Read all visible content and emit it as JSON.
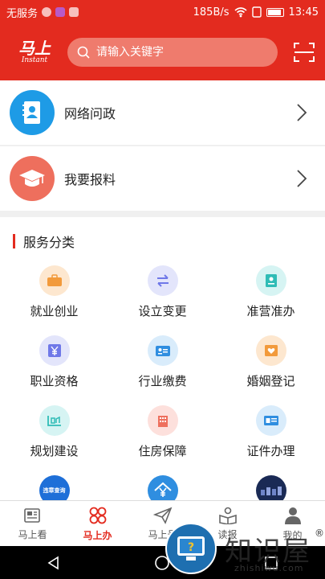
{
  "status_bar": {
    "carrier": "无服务",
    "speed": "185B/s",
    "time": "13:45"
  },
  "header": {
    "logo_cn": "马上",
    "logo_en": "Instant",
    "search_placeholder": "请输入关键字"
  },
  "list_rows": [
    {
      "label": "网络问政",
      "icon": "contact-book-icon",
      "color": "#1e9be6"
    },
    {
      "label": "我要报料",
      "icon": "graduation-cap-icon",
      "color": "#ee6f5d"
    }
  ],
  "services": {
    "title": "服务分类",
    "items": [
      {
        "label": "就业创业",
        "icon": "briefcase-icon",
        "bg": "#fde7cf",
        "fg": "#f29a3b"
      },
      {
        "label": "设立变更",
        "icon": "swap-arrows-icon",
        "bg": "#e3e5fb",
        "fg": "#6f78e8"
      },
      {
        "label": "准营准办",
        "icon": "certificate-icon",
        "bg": "#d6f4f3",
        "fg": "#2fbcb6"
      },
      {
        "label": "职业资格",
        "icon": "yuan-badge-icon",
        "bg": "#e3e5fb",
        "fg": "#6f78e8"
      },
      {
        "label": "行业缴费",
        "icon": "id-card-icon",
        "bg": "#d9ecfb",
        "fg": "#2f8ee0"
      },
      {
        "label": "婚姻登记",
        "icon": "heart-certificate-icon",
        "bg": "#fde7cf",
        "fg": "#f29a3b"
      },
      {
        "label": "规划建设",
        "icon": "blueprint-icon",
        "bg": "#d6f4f3",
        "fg": "#2fbcb6"
      },
      {
        "label": "住房保障",
        "icon": "building-icon",
        "bg": "#fde0dc",
        "fg": "#ee6f5d"
      },
      {
        "label": "证件办理",
        "icon": "license-icon",
        "bg": "#d9ecfb",
        "fg": "#2f8ee0"
      },
      {
        "label": "违章查询",
        "icon": "violation-query-icon",
        "bg": "#1e6fd8",
        "fg": "#ffffff"
      },
      {
        "label": "",
        "icon": "house-yuan-icon",
        "bg": "#2f8ee0",
        "fg": "#ffffff"
      },
      {
        "label": "",
        "icon": "photo-thumbnail-icon",
        "bg": "#1a2a55",
        "fg": "#ffffff"
      }
    ]
  },
  "tabbar": {
    "tabs": [
      {
        "label": "马上看",
        "icon": "newspaper-icon",
        "active": false
      },
      {
        "label": "马上办",
        "icon": "four-petal-icon",
        "active": true
      },
      {
        "label": "马上号",
        "icon": "paper-plane-icon",
        "active": false
      },
      {
        "label": "读报",
        "icon": "reading-icon",
        "active": false
      },
      {
        "label": "我的",
        "icon": "person-icon",
        "active": false
      }
    ]
  },
  "watermark": {
    "text_cn": "知识屋",
    "text_en": "zhishiwu.com",
    "registered": "®"
  },
  "colors": {
    "brand_red": "#e32b1f"
  }
}
